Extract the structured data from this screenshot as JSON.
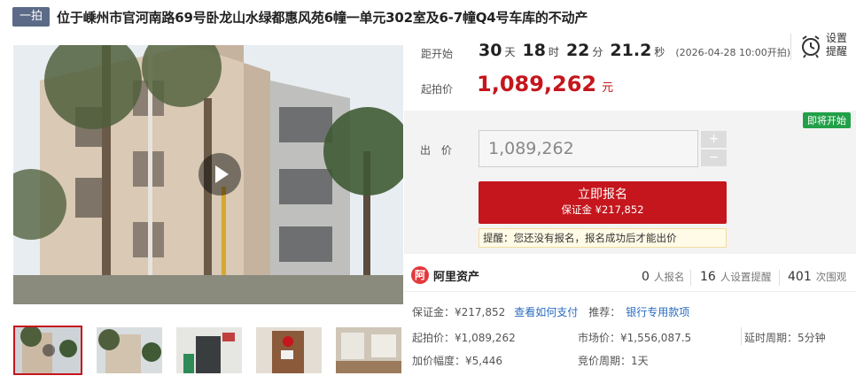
{
  "header": {
    "badge": "一拍",
    "title": "位于嵊州市官河南路69号卧龙山水绿都惠风苑6幢一单元302室及6-7幢Q4号车库的不动产"
  },
  "countdown": {
    "label": "距开始",
    "days": "30",
    "days_unit": "天",
    "hours": "18",
    "hours_unit": "时",
    "minutes": "22",
    "minutes_unit": "分",
    "seconds": "21.2",
    "seconds_unit": "秒",
    "start_note": "(2026-04-28 10:00开拍)"
  },
  "reminder": {
    "line1": "设置",
    "line2": "提醒",
    "icon": "alarm-clock-icon"
  },
  "start_price": {
    "label": "起拍价",
    "value": "1,089,262",
    "unit": "元"
  },
  "bid": {
    "status_badge": "即将开始",
    "label": "出 价",
    "input_value": "1,089,262",
    "plus": "+",
    "minus": "−",
    "register_label": "立即报名",
    "register_deposit": "保证金 ¥217,852",
    "hint": "提醒：您还没有报名，报名成功后才能出价"
  },
  "platform": {
    "logo_char": "阿",
    "name": "阿里资产",
    "stats": [
      {
        "num": "0",
        "label": "人报名"
      },
      {
        "num": "16",
        "label": "人设置提醒"
      },
      {
        "num": "401",
        "label": "次围观"
      }
    ]
  },
  "deposit_row": {
    "deposit": "保证金：¥217,852",
    "how_to_pay": "查看如何支付",
    "recommend": "推荐：",
    "bank_account": "银行专用款项"
  },
  "details": {
    "start_price": "起拍价：¥1,089,262",
    "market_price": "市场价：¥1,556,087.5",
    "delay_period": "延时周期：5分钟",
    "increment": "加价幅度：¥5,446",
    "bid_period": "竞价周期：1天"
  },
  "colors": {
    "accent": "#c4161c",
    "badge_bg": "#5b6a87",
    "status_green": "#22a048",
    "link": "#2a6bbf"
  }
}
